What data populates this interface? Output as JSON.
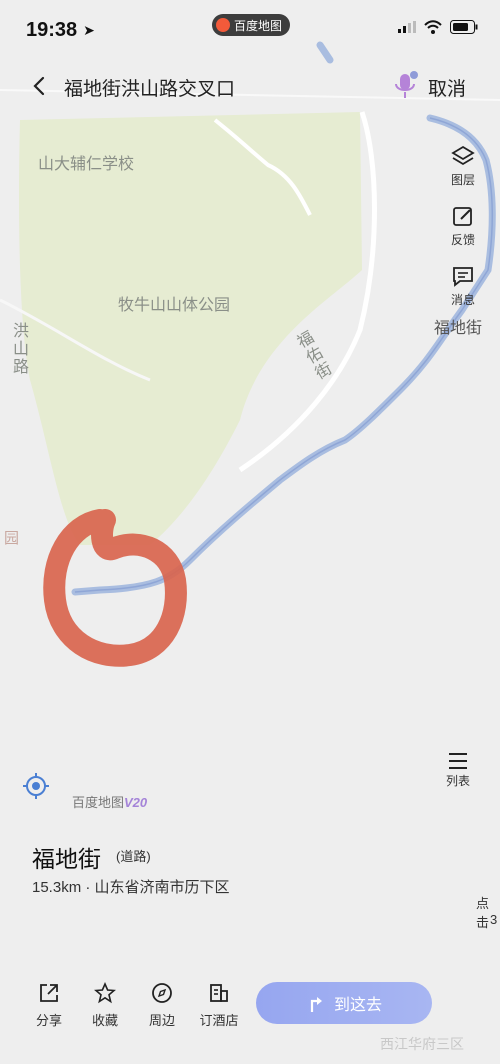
{
  "status_bar": {
    "time": "19:38",
    "app_badge": "百度地图"
  },
  "top_bar": {
    "search_text": "福地街洪山路交叉口",
    "cancel_label": "取消"
  },
  "map_labels": {
    "school": "山大辅仁学校",
    "park": "牧牛山山体公园",
    "hongshan_road": "洪山路",
    "fudi_street_road": "福佑街",
    "fudi_street": "福地街",
    "edge_park": "园"
  },
  "right_tools": {
    "layers": "图层",
    "feedback": "反馈",
    "messages": "消息"
  },
  "list_button": "列表",
  "brand": {
    "name": "百度地图",
    "version": "V20"
  },
  "place": {
    "name": "福地街",
    "type": "(道路)",
    "detail": "15.3km · 山东省济南市历下区"
  },
  "edge_text": {
    "line1": "点击",
    "line2": "3"
  },
  "actions": {
    "share": "分享",
    "favorite": "收藏",
    "nearby": "周边",
    "hotel": "订酒店",
    "go": "到这去"
  },
  "faint_bottom": "西江华府三区",
  "colors": {
    "park_fill": "#e8edd6",
    "road_blue": "#a9bde0",
    "scribble_red": "#d9654e",
    "go_button": "#9aaaf0"
  }
}
